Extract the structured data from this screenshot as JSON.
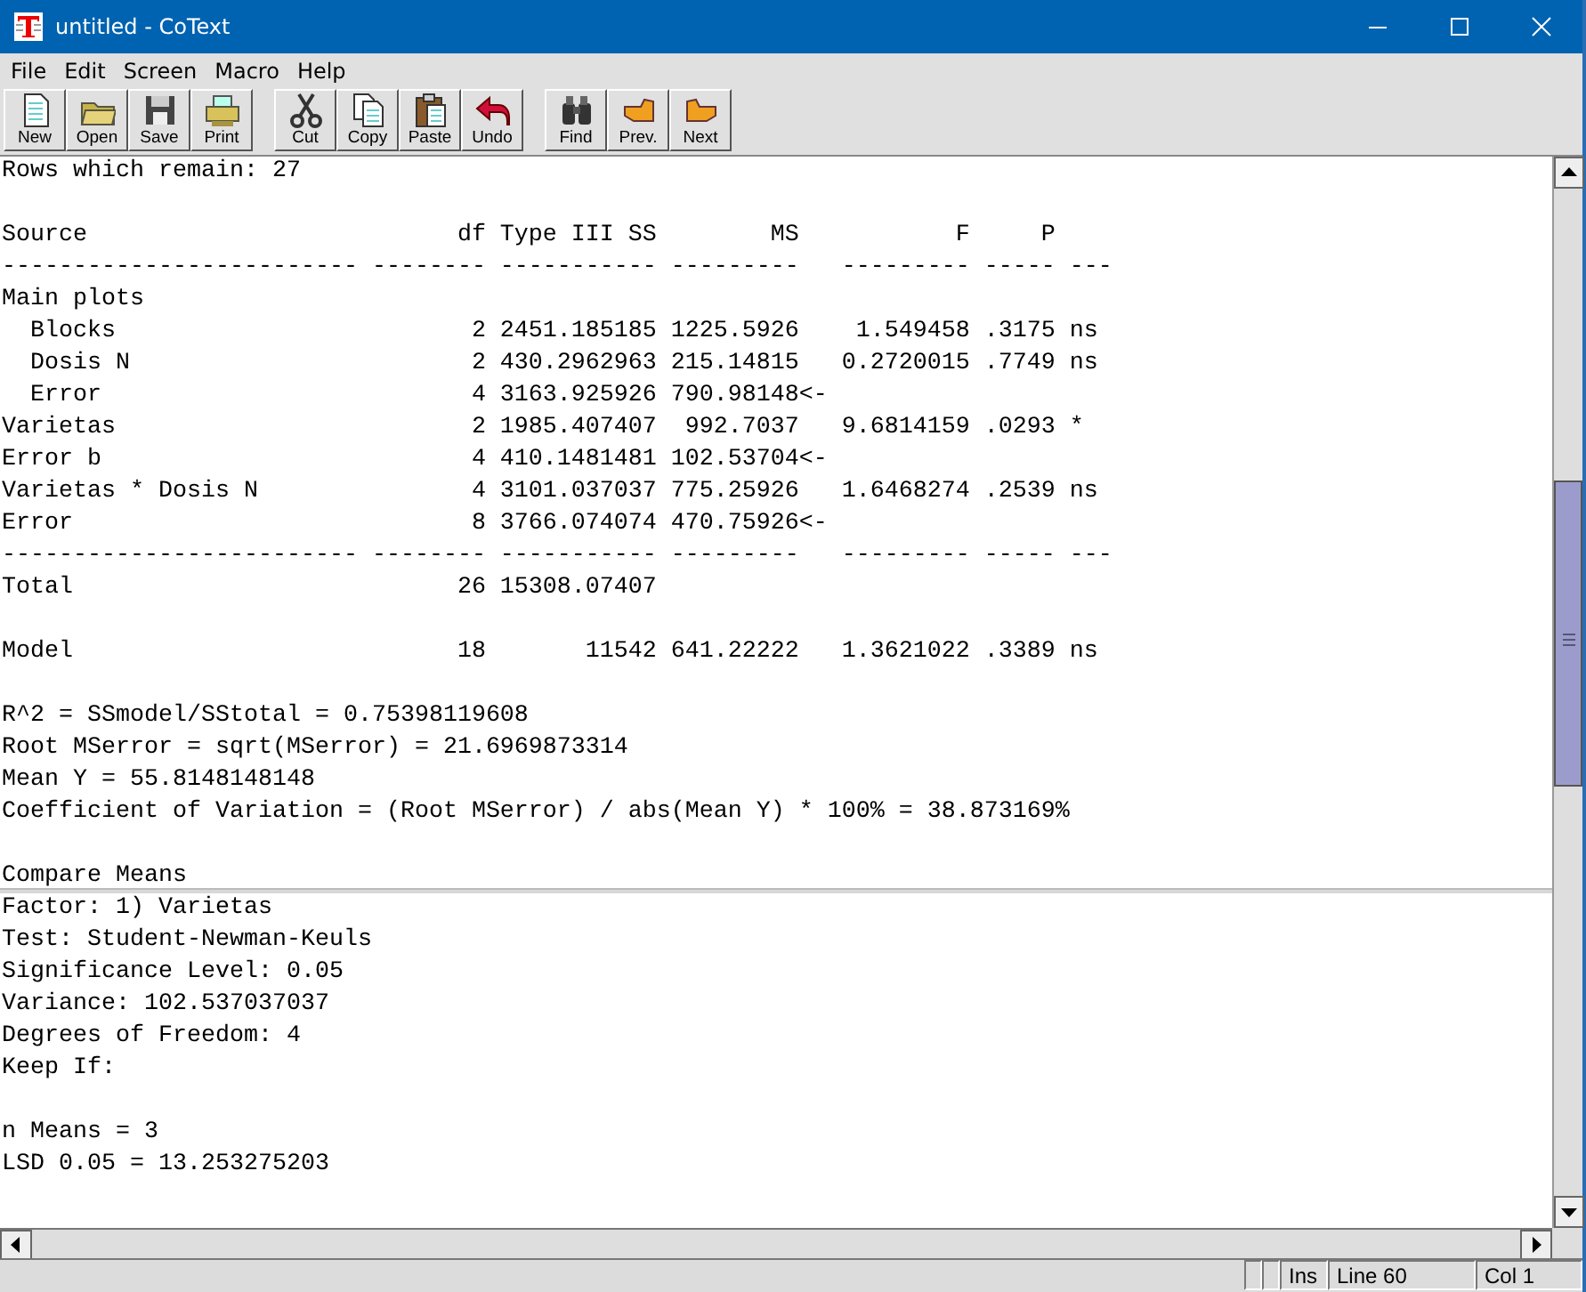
{
  "window": {
    "title": "untitled - CoText"
  },
  "menu": [
    "File",
    "Edit",
    "Screen",
    "Macro",
    "Help"
  ],
  "toolbar": [
    {
      "buttons": [
        {
          "label": "New"
        },
        {
          "label": "Open"
        },
        {
          "label": "Save"
        },
        {
          "label": "Print"
        }
      ]
    },
    {
      "buttons": [
        {
          "label": "Cut"
        },
        {
          "label": "Copy"
        },
        {
          "label": "Paste"
        },
        {
          "label": "Undo"
        }
      ]
    },
    {
      "buttons": [
        {
          "label": "Find"
        },
        {
          "label": "Prev."
        },
        {
          "label": "Next"
        }
      ]
    }
  ],
  "upper_pane": {
    "blocks": [
      [
        "Rows which remain: 27"
      ],
      [
        "Source                          df Type III SS        MS           F     P",
        "------------------------- -------- ----------- ---------   --------- ----- ---",
        "Main plots",
        "  Blocks                         2 2451.185185 1225.5926    1.549458 .3175 ns",
        "  Dosis N                        2 430.2962963 215.14815   0.2720015 .7749 ns",
        "  Error                          4 3163.925926 790.98148<-",
        "Varietas                         2 1985.407407  992.7037   9.6814159 .0293 *",
        "Error b                          4 410.1481481 102.53704<-",
        "Varietas * Dosis N               4 3101.037037 775.25926   1.6468274 .2539 ns",
        "Error                            8 3766.074074 470.75926<-",
        "------------------------- -------- ----------- ---------   --------- ----- ---",
        "Total                           26 15308.07407"
      ],
      [
        "Model                           18       11542 641.22222   1.3621022 .3389 ns"
      ],
      [
        "R^2 = SSmodel/SStotal = 0.75398119608",
        "Root MSerror = sqrt(MSerror) = 21.6969873314",
        "Mean Y = 55.8148148148",
        "Coefficient of Variation = (Root MSerror) / abs(Mean Y) * 100% = 38.873169%"
      ],
      [
        "Compare Means"
      ]
    ]
  },
  "lower_pane": {
    "blocks": [
      [
        "Factor: 1) Varietas",
        "Test: Student-Newman-Keuls",
        "Significance Level: 0.05",
        "Variance: 102.537037037",
        "Degrees of Freedom: 4",
        "Keep If:"
      ],
      [
        "n Means = 3",
        "LSD 0.05 = 13.253275203"
      ]
    ]
  },
  "status_bar": {
    "panels": [
      "Ins",
      "Line 60",
      "Col 1"
    ]
  }
}
